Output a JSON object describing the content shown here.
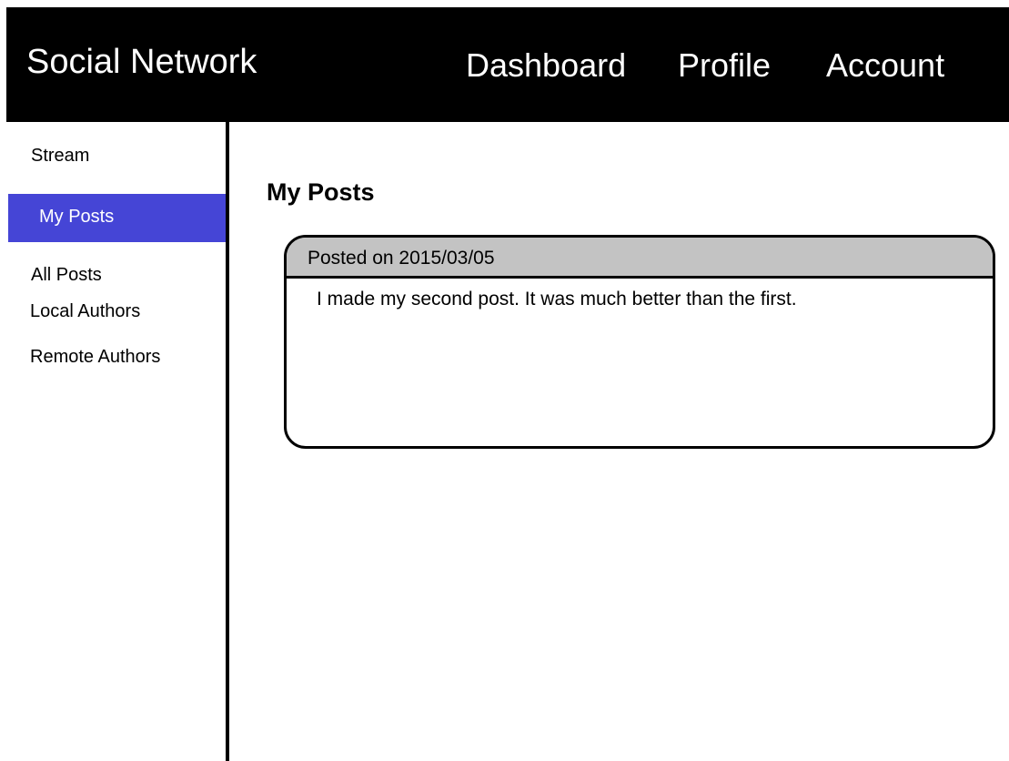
{
  "app": {
    "title": "Social Network"
  },
  "nav": {
    "dashboard": "Dashboard",
    "profile": "Profile",
    "account": "Account"
  },
  "sidebar": {
    "items": [
      {
        "label": "Stream"
      },
      {
        "label": "My Posts",
        "active": true
      },
      {
        "label": "All Posts"
      },
      {
        "label": "Local Authors"
      },
      {
        "label": "Remote Authors"
      }
    ]
  },
  "main": {
    "title": "My Posts",
    "posts": [
      {
        "date_text": "Posted on 2015/03/05",
        "content": "I made my second post.  It was much better than the first."
      }
    ]
  },
  "colors": {
    "topbar": "#000000",
    "active_sidebar": "#4545d6",
    "post_header": "#c3c3c3"
  }
}
